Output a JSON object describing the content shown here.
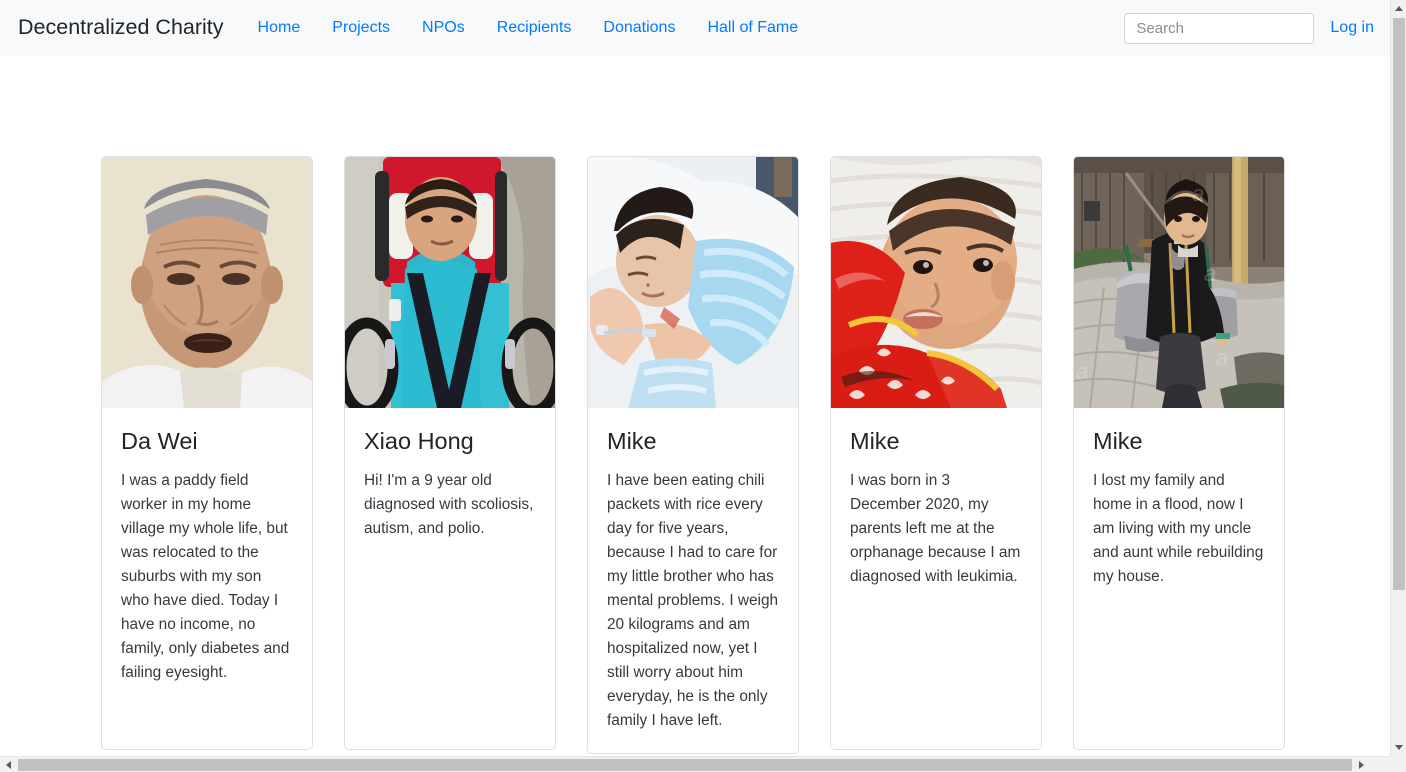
{
  "navbar": {
    "brand": "Decentralized Charity",
    "links": [
      {
        "label": "Home"
      },
      {
        "label": "Projects"
      },
      {
        "label": "NPOs"
      },
      {
        "label": "Recipients"
      },
      {
        "label": "Donations"
      },
      {
        "label": "Hall of Fame"
      }
    ],
    "search": {
      "value": "",
      "placeholder": "Search"
    },
    "login_label": "Log in",
    "background_color": "#f8f9fa",
    "link_color": "#007bff"
  },
  "cards": [
    {
      "name": "Da Wei",
      "text": "I was a paddy field worker in my home village my whole life, but was relocated to the suburbs with my son who have died. Today I have no income, no family, only diabetes and failing eyesight.",
      "image_name": "photo-elderly-man-portrait"
    },
    {
      "name": "Xiao Hong",
      "text": "Hi! I'm a 9 year old diagnosed with scoliosis, autism, and polio.",
      "image_name": "photo-boy-in-wheelchair"
    },
    {
      "name": "Mike",
      "text": "I have been eating chili packets with rice every day for five years, because I had to care for my little brother who has mental problems. I weigh 20 kilograms and am hospitalized now, yet I still worry about him everyday, he is the only family I have left.",
      "image_name": "photo-child-in-hospital-bed"
    },
    {
      "name": "Mike",
      "text": "I was born in 3 December 2020, my parents left me at the orphanage because I am diagnosed with leukimia.",
      "image_name": "photo-baby-in-red-outfit"
    },
    {
      "name": "Mike",
      "text": "I lost my family and home in a flood, now I am living with my uncle and aunt while rebuilding my house.",
      "image_name": "photo-woman-carrying-water-buckets"
    }
  ],
  "scrollbars": {
    "vertical_icon_up": "scroll-up-arrow",
    "vertical_icon_down": "scroll-down-arrow",
    "horizontal_icon_left": "scroll-left-arrow",
    "horizontal_icon_right": "scroll-right-arrow"
  }
}
